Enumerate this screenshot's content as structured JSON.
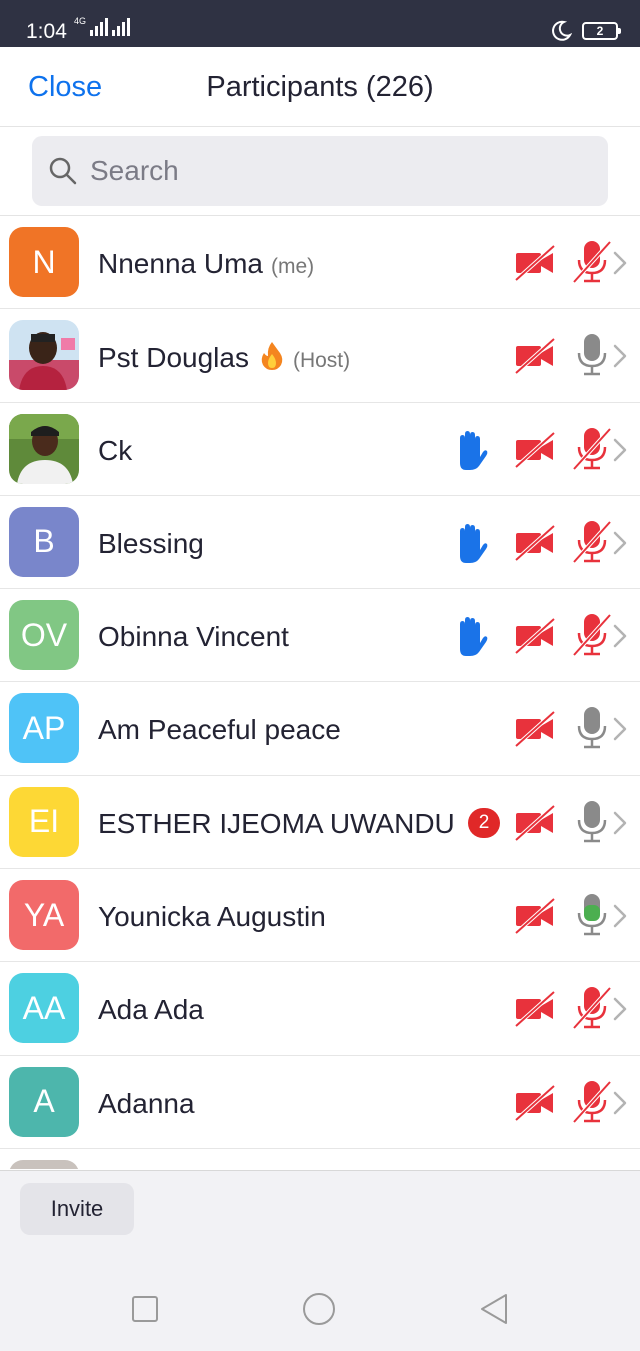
{
  "status_bar": {
    "time": "1:04",
    "network": "4G",
    "battery": "2"
  },
  "header": {
    "close_label": "Close",
    "title": "Participants (226)"
  },
  "search": {
    "placeholder": "Search",
    "value": ""
  },
  "participants": [
    {
      "name": "Nnenna Uma",
      "tag": "(me)",
      "initials": "N",
      "avatar_color": "#f07426",
      "video": "off",
      "mic": "muted"
    },
    {
      "name": "Pst Douglas",
      "tag": "(Host)",
      "emoji": "fire",
      "avatar": "photo",
      "video": "off",
      "mic": "unmuted"
    },
    {
      "name": "Ck",
      "avatar": "photo",
      "hand_raised": true,
      "video": "off",
      "mic": "muted"
    },
    {
      "name": "Blessing",
      "initials": "B",
      "avatar_color": "#7986cb",
      "hand_raised": true,
      "video": "off",
      "mic": "muted"
    },
    {
      "name": "Obinna Vincent",
      "initials": "OV",
      "avatar_color": "#81c784",
      "hand_raised": true,
      "video": "off",
      "mic": "muted"
    },
    {
      "name": "Am Peaceful peace",
      "initials": "AP",
      "avatar_color": "#4fc3f7",
      "video": "off",
      "mic": "unmuted"
    },
    {
      "name": "ESTHER IJEOMA UWANDU",
      "initials": "EI",
      "avatar_color": "#fdd835",
      "badge": "2",
      "video": "off",
      "mic": "unmuted"
    },
    {
      "name": "Younicka Augustin",
      "initials": "YA",
      "avatar_color": "#f26a6a",
      "video": "off",
      "mic": "speaking"
    },
    {
      "name": "Ada Ada",
      "initials": "AA",
      "avatar_color": "#4dd0e1",
      "video": "off",
      "mic": "muted"
    },
    {
      "name": "Adanna",
      "initials": "A",
      "avatar_color": "#4db6ac",
      "video": "off",
      "mic": "muted"
    }
  ],
  "footer": {
    "invite_label": "Invite"
  },
  "colors": {
    "accent": "#0e72ed",
    "muted_red": "#e8323c",
    "hand_blue": "#1a73e8",
    "mic_grey": "#8a8a8a",
    "speaking_green": "#4caf50"
  },
  "icons": {
    "search": "search-icon",
    "video_off": "video-off-icon",
    "mic_muted": "mic-muted-icon",
    "mic": "mic-icon",
    "hand": "raised-hand-icon",
    "chevron": "chevron-right-icon"
  }
}
